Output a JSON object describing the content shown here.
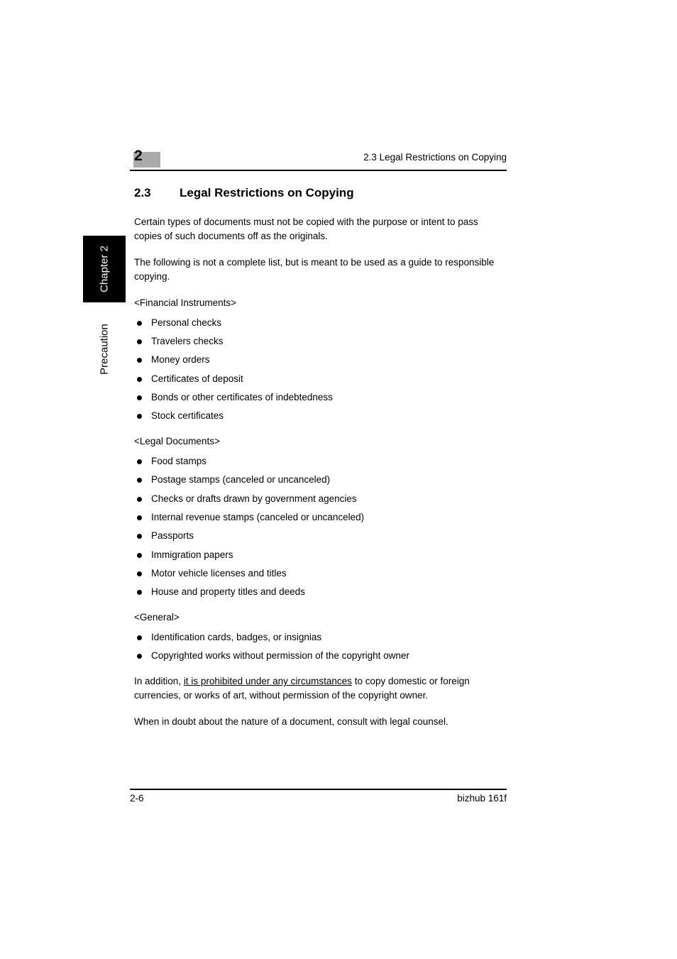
{
  "header": {
    "chapter_number": "2",
    "running_title": "2.3 Legal Restrictions on Copying"
  },
  "margin_tabs": {
    "chapter_tab": "Chapter 2",
    "section_tab": "Precaution"
  },
  "section": {
    "number": "2.3",
    "title": "Legal Restrictions on Copying"
  },
  "intro": {
    "paragraph_1": "Certain types of documents must not be copied with the purpose or intent to pass copies of such documents off as the originals.",
    "paragraph_2": "The following is not a complete list, but is meant to be used as a guide to responsible copying."
  },
  "groups": [
    {
      "label": "<Financial Instruments>",
      "items": [
        "Personal checks",
        "Travelers checks",
        "Money orders",
        "Certificates of deposit",
        "Bonds or other certificates of indebtedness",
        "Stock certificates"
      ]
    },
    {
      "label": "<Legal Documents>",
      "items": [
        "Food stamps",
        "Postage stamps (canceled or uncanceled)",
        "Checks or drafts drawn by government agencies",
        "Internal revenue stamps (canceled or uncanceled)",
        "Passports",
        "Immigration papers",
        "Motor vehicle licenses and titles",
        "House and property titles and deeds"
      ]
    },
    {
      "label": "<General>",
      "items": [
        "Identification cards, badges, or insignias",
        "Copyrighted works without permission of the copyright owner"
      ]
    }
  ],
  "closing": {
    "addition_lead": "In addition, ",
    "addition_underlined": "it is prohibited under any circumstances",
    "addition_tail": " to copy domestic or foreign currencies, or works of art, without permission of the copyright owner.",
    "doubt_paragraph": "When in doubt about the nature of a document, consult with legal counsel."
  },
  "footer": {
    "page_number": "2-6",
    "product": "bizhub 161f"
  }
}
